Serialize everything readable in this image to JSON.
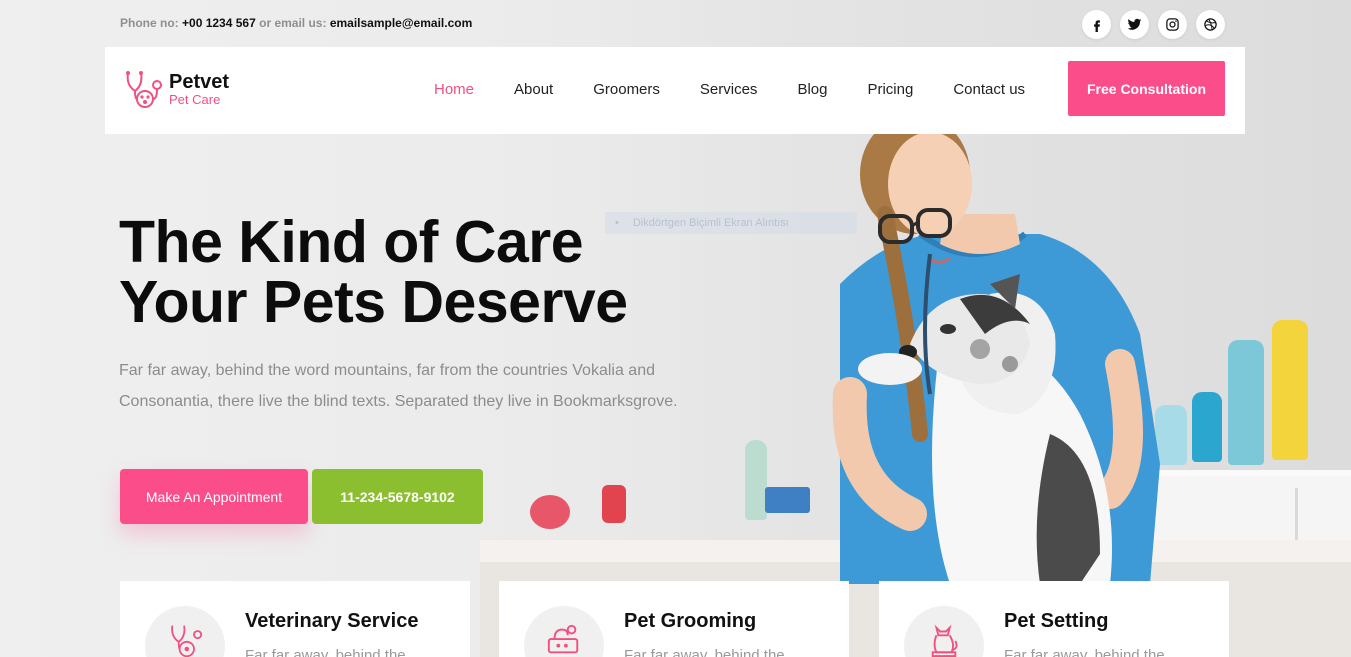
{
  "topbar": {
    "phone_label": "Phone no:",
    "phone": "+00 1234 567",
    "email_label": "or email us:",
    "email": "emailsample@email.com"
  },
  "socials": [
    {
      "icon": "facebook-icon"
    },
    {
      "icon": "twitter-icon"
    },
    {
      "icon": "instagram-icon"
    },
    {
      "icon": "dribbble-icon"
    }
  ],
  "brand": {
    "name": "Petvet",
    "tagline": "Pet Care",
    "accent_color": "#fb4d8a",
    "green_color": "#8bbf30"
  },
  "nav": {
    "items": [
      "Home",
      "About",
      "Groomers",
      "Services",
      "Blog",
      "Pricing",
      "Contact us"
    ],
    "active": "Home",
    "cta": "Free Consultation"
  },
  "hero": {
    "line1": "The Kind of Care",
    "line2": "Your Pets Deserve",
    "description": "Far far away, behind the word mountains, far from the countries Vokalia and Consonantia, there live the blind texts. Separated they live in Bookmarksgrove.",
    "appointment_button": "Make An Appointment",
    "phone_button": "11-234-5678-9102",
    "ghost_tooltip": "Dikdörtgen Biçimli Ekran Alıntısı"
  },
  "services": [
    {
      "title": "Veterinary Service",
      "text": "Far far away, behind the",
      "icon": "stethoscope-icon"
    },
    {
      "title": "Pet Grooming",
      "text": "Far far away, behind the",
      "icon": "grooming-icon"
    },
    {
      "title": "Pet Setting",
      "text": "Far far away, behind the",
      "icon": "cat-icon"
    }
  ]
}
